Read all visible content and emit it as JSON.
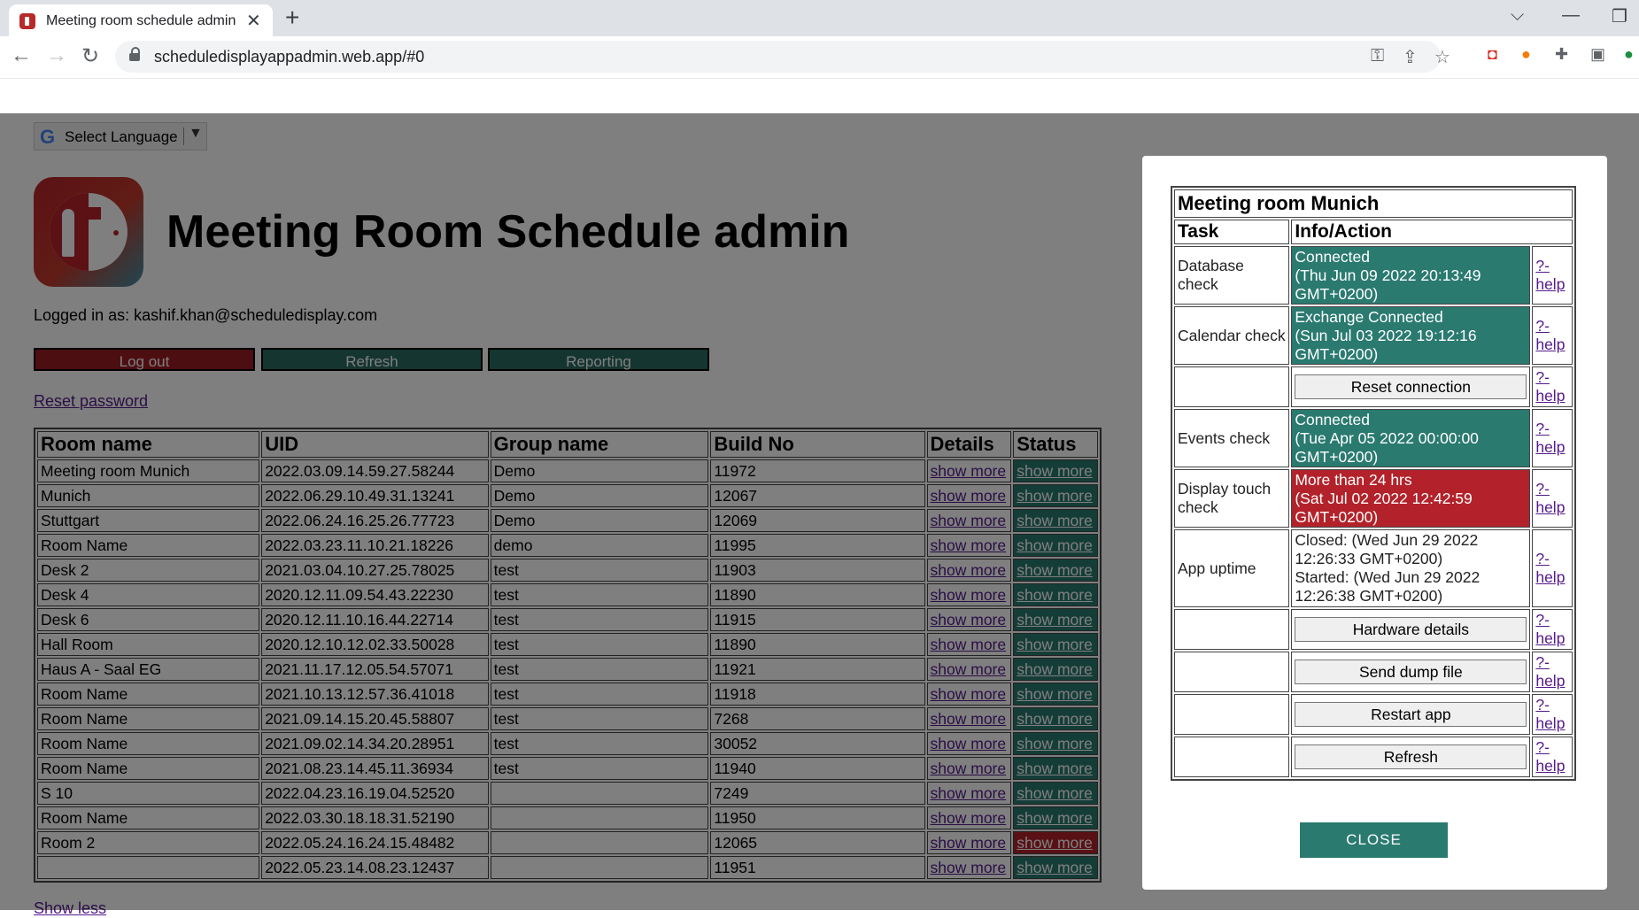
{
  "browser": {
    "tab_title": "Meeting room schedule admin",
    "tab_close": "✕",
    "new_tab": "+",
    "url": "scheduledisplayappadmin.web.app/#0"
  },
  "page": {
    "language_selector": "Select Language",
    "title": "Meeting Room Schedule admin",
    "logged_in": "Logged in as: kashif.khan@scheduledisplay.com",
    "buttons": {
      "logout": "Log out",
      "refresh": "Refresh",
      "reporting": "Reporting"
    },
    "reset_password": "Reset password",
    "show_less": "Show less",
    "colors": {
      "red": "#b3222a",
      "teal": "#2a7a70",
      "logout_bg": "#9b1c24",
      "refresh_bg": "#2a6a60"
    }
  },
  "rooms_table": {
    "headers": [
      "Room name",
      "UID",
      "Group name",
      "Build No",
      "Details",
      "Status"
    ],
    "link_text": "show more",
    "rows": [
      {
        "name": "Meeting room Munich",
        "uid": "2022.03.09.14.59.27.58244",
        "group": "Demo",
        "build": "11972",
        "status": "ok"
      },
      {
        "name": "Munich",
        "uid": "2022.06.29.10.49.31.13241",
        "group": "Demo",
        "build": "12067",
        "status": "ok"
      },
      {
        "name": "Stuttgart",
        "uid": "2022.06.24.16.25.26.77723",
        "group": "Demo",
        "build": "12069",
        "status": "ok"
      },
      {
        "name": "Room Name",
        "uid": "2022.03.23.11.10.21.18226",
        "group": "demo",
        "build": "11995",
        "status": "ok"
      },
      {
        "name": "Desk 2",
        "uid": "2021.03.04.10.27.25.78025",
        "group": "test",
        "build": "11903",
        "status": "ok"
      },
      {
        "name": "Desk 4",
        "uid": "2020.12.11.09.54.43.22230",
        "group": "test",
        "build": "11890",
        "status": "ok"
      },
      {
        "name": "Desk 6",
        "uid": "2020.12.11.10.16.44.22714",
        "group": "test",
        "build": "11915",
        "status": "ok"
      },
      {
        "name": "Hall Room",
        "uid": "2020.12.10.12.02.33.50028",
        "group": "test",
        "build": "11890",
        "status": "ok"
      },
      {
        "name": "Haus A - Saal EG",
        "uid": "2021.11.17.12.05.54.57071",
        "group": "test",
        "build": "11921",
        "status": "ok"
      },
      {
        "name": "Room Name",
        "uid": "2021.10.13.12.57.36.41018",
        "group": "test",
        "build": "11918",
        "status": "ok"
      },
      {
        "name": "Room Name",
        "uid": "2021.09.14.15.20.45.58807",
        "group": "test",
        "build": "7268",
        "status": "ok"
      },
      {
        "name": "Room Name",
        "uid": "2021.09.02.14.34.20.28951",
        "group": "test",
        "build": "30052",
        "status": "ok"
      },
      {
        "name": "Room Name",
        "uid": "2021.08.23.14.45.11.36934",
        "group": "test",
        "build": "11940",
        "status": "ok"
      },
      {
        "name": "S 10",
        "uid": "2022.04.23.16.19.04.52520",
        "group": "",
        "build": "7249",
        "status": "ok"
      },
      {
        "name": "Room Name",
        "uid": "2022.03.30.18.18.31.52190",
        "group": "",
        "build": "11950",
        "status": "ok"
      },
      {
        "name": "Room 2",
        "uid": "2022.05.24.16.24.15.48482",
        "group": "",
        "build": "12065",
        "status": "bad"
      },
      {
        "name": "",
        "uid": "2022.05.23.14.08.23.12437",
        "group": "",
        "build": "11951",
        "status": "ok"
      }
    ]
  },
  "modal": {
    "title": "Meeting room Munich",
    "col_task": "Task",
    "col_info": "Info/Action",
    "help_label": "?-help",
    "rows": {
      "database": {
        "task": "Database check",
        "l1": "Connected",
        "l2": "(Thu Jun 09 2022 20:13:49",
        "l3": "GMT+0200)"
      },
      "calendar": {
        "task": "Calendar check",
        "l1": "Exchange Connected",
        "l2": "(Sun Jul 03 2022 19:12:16",
        "l3": "GMT+0200)"
      },
      "reset": {
        "button": "Reset connection"
      },
      "events": {
        "task": "Events check",
        "l1": "Connected",
        "l2": "(Tue Apr 05 2022 00:00:00",
        "l3": "GMT+0200)"
      },
      "touch": {
        "task1": "Display touch",
        "task2": "check",
        "l1": "More than 24 hrs",
        "l2": "(Sat Jul 02 2022 12:42:59",
        "l3": "GMT+0200)"
      },
      "uptime": {
        "task": "App uptime",
        "l1": "Closed: (Wed Jun 29 2022",
        "l2": "12:26:33 GMT+0200)",
        "l3": "Started: (Wed Jun 29 2022",
        "l4": "12:26:38 GMT+0200)"
      },
      "hardware": {
        "button": "Hardware details"
      },
      "dump": {
        "button": "Send dump file"
      },
      "restart": {
        "button": "Restart app"
      },
      "refresh": {
        "button": "Refresh"
      }
    },
    "close": "CLOSE"
  }
}
